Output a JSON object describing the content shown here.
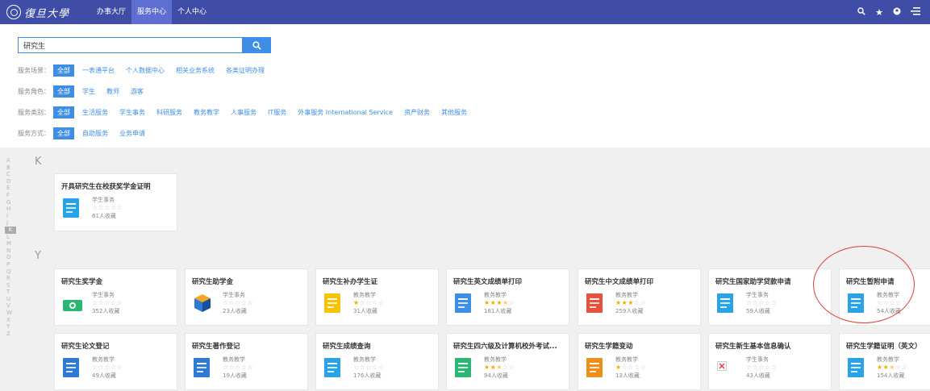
{
  "header": {
    "logo_text": "復旦大學",
    "nav": [
      {
        "label": "办事大厅",
        "active": false
      },
      {
        "label": "服务中心",
        "active": true
      },
      {
        "label": "个人中心",
        "active": false
      }
    ],
    "icons": [
      "search-icon",
      "star-icon",
      "user-icon",
      "menu-icon"
    ]
  },
  "search": {
    "value": "研究生",
    "button_icon": "search-icon"
  },
  "filters": [
    {
      "label": "服务场景：",
      "options": [
        "全部",
        "一表通平台",
        "个人数据中心",
        "相关业务系统",
        "各类证明办理"
      ],
      "selected": 0
    },
    {
      "label": "服务角色：",
      "options": [
        "全部",
        "学生",
        "教师",
        "游客"
      ],
      "selected": 0
    },
    {
      "label": "服务类别：",
      "options": [
        "全部",
        "生活服务",
        "学生事务",
        "科研服务",
        "教务教学",
        "人事服务",
        "IT服务",
        "外事服务 International Service",
        "资产财务",
        "其他服务"
      ],
      "selected": 0
    },
    {
      "label": "服务方式：",
      "options": [
        "全部",
        "自助服务",
        "业务申请"
      ],
      "selected": 0
    }
  ],
  "alphabet": [
    "A",
    "B",
    "C",
    "D",
    "E",
    "F",
    "G",
    "H",
    "I",
    "J",
    "K",
    "L",
    "M",
    "N",
    "O",
    "P",
    "Q",
    "R",
    "S",
    "T",
    "U",
    "V",
    "W",
    "X",
    "Y",
    "Z"
  ],
  "alphabet_active": "K",
  "sections": [
    {
      "letter": "K",
      "cards": [
        {
          "title": "开具研究生在校获奖学金证明",
          "category": "学生事务",
          "stars": 0,
          "favorites": "61人收藏",
          "icon": "certificate-icon",
          "color": "#29a3e8"
        }
      ]
    },
    {
      "letter": "Y",
      "cards": [
        {
          "title": "研究生奖学金",
          "category": "学生事务",
          "stars": 0,
          "favorites": "352人收藏",
          "icon": "money-icon",
          "color": "#2bb673"
        },
        {
          "title": "研究生助学金",
          "category": "学生事务",
          "stars": 0,
          "favorites": "23人收藏",
          "icon": "cube-icon",
          "color": "#2e7bd6"
        },
        {
          "title": "研究生补办学生证",
          "category": "教务教学",
          "stars": 1,
          "favorites": "31人收藏",
          "icon": "id-card-icon",
          "color": "#f5c300"
        },
        {
          "title": "研究生英文成绩单打印",
          "category": "教务教学",
          "stars": 3.5,
          "favorites": "181人收藏",
          "icon": "transcript-icon",
          "color": "#3f8ee6"
        },
        {
          "title": "研究生中文成绩单打印",
          "category": "教务教学",
          "stars": 3,
          "favorites": "259人收藏",
          "icon": "transcript-icon",
          "color": "#e8503a"
        },
        {
          "title": "研究生国家助学贷款申请",
          "category": "学生事务",
          "stars": 0,
          "favorites": "59人收藏",
          "icon": "document-icon",
          "color": "#29a3e8"
        },
        {
          "title": "研究生暂附申请",
          "category": "教务教学",
          "stars": 0,
          "favorites": "54人收藏",
          "icon": "document-icon",
          "color": "#29a3e8"
        },
        {
          "title": "研究生论文登记",
          "category": "教务教学",
          "stars": 0,
          "favorites": "49人收藏",
          "icon": "paper-icon",
          "color": "#2e7bd6"
        },
        {
          "title": "研究生著作登记",
          "category": "教务教学",
          "stars": 0,
          "favorites": "19人收藏",
          "icon": "book-icon",
          "color": "#2e7bd6"
        },
        {
          "title": "研究生成绩查询",
          "category": "教务教学",
          "stars": 0,
          "favorites": "176人收藏",
          "icon": "query-icon",
          "color": "#29a3e8"
        },
        {
          "title": "研究生四六级及计算机校外考试...",
          "category": "教务教学",
          "stars": 2.5,
          "favorites": "94人收藏",
          "icon": "exam-icon",
          "color": "#2bb673"
        },
        {
          "title": "研究生学籍变动",
          "category": "教务教学",
          "stars": 1,
          "favorites": "13人收藏",
          "icon": "status-icon",
          "color": "#f08c1a"
        },
        {
          "title": "研究生新生基本信息确认",
          "category": "学生事务",
          "stars": 0,
          "favorites": "43人收藏",
          "icon": "broken-image-icon",
          "color": "#ffffff"
        },
        {
          "title": "研究生学籍证明（英文）",
          "category": "教务教学",
          "stars": 2.5,
          "favorites": "154人收藏",
          "icon": "certificate-icon",
          "color": "#29a3e8"
        }
      ]
    }
  ]
}
